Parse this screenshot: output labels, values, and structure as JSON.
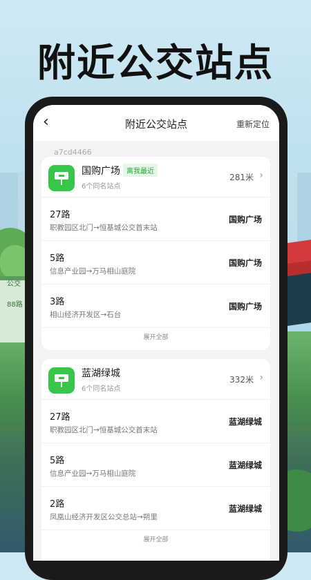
{
  "headline": "附近公交站点",
  "background": {
    "shelter_label_1": "公交",
    "shelter_label_2": "88路"
  },
  "nav": {
    "back_icon": "chevron-left-icon",
    "title": "附近公交站点",
    "relocate": "重新定位"
  },
  "watermark": "a7cd4466",
  "stops": [
    {
      "name": "国购广场",
      "badge": "离我最近",
      "same_count": "6个同名站点",
      "distance": "281米",
      "routes": [
        {
          "name": "27路",
          "path": "职教园区北门→恒基城公交首末站",
          "dest": "国购广场"
        },
        {
          "name": "5路",
          "path": "信息产业园→万马相山庭院",
          "dest": "国购广场"
        },
        {
          "name": "3路",
          "path": "相山经济开发区→石台",
          "dest": "国购广场"
        }
      ],
      "expand": "展开全部"
    },
    {
      "name": "蓝湖绿城",
      "same_count": "6个同名站点",
      "distance": "332米",
      "routes": [
        {
          "name": "27路",
          "path": "职教园区北门→恒基城公交首末站",
          "dest": "蓝湖绿城"
        },
        {
          "name": "5路",
          "path": "信息产业园→万马相山庭院",
          "dest": "蓝湖绿城"
        },
        {
          "name": "2路",
          "path": "凤凰山经济开发区公交总站→朔里",
          "dest": "蓝湖绿城"
        }
      ],
      "expand": "展开全部"
    }
  ],
  "colors": {
    "accent_green": "#38c64a",
    "badge_bg": "#e4f6e6"
  }
}
